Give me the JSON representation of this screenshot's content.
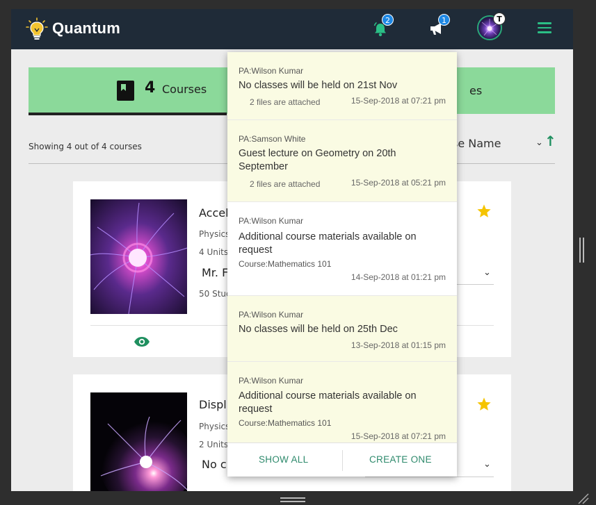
{
  "app": {
    "brand": "Quantum",
    "notifications_badge": "2",
    "announcements_badge": "1",
    "avatar_badge": "T"
  },
  "summary": {
    "course_count": "4",
    "course_label": "Courses",
    "right_label_partial": "es"
  },
  "list": {
    "showing_text": "Showing 4 out of 4 courses",
    "sort_label": "se Name",
    "sort_direction": "ascending"
  },
  "courses": [
    {
      "title_partial": "Accel",
      "subject_partial": "Physics",
      "units_partial": "4 Units",
      "teacher_partial": "Mr. F",
      "students_partial": "50 Stud",
      "starred": true
    },
    {
      "title_partial": "Displ",
      "subject_partial": "Physics",
      "units_partial": "2 Units",
      "teacher_partial": "No c",
      "starred": true
    }
  ],
  "notifications": {
    "items": [
      {
        "from": "PA:Wilson Kumar",
        "message": "No classes will be held on 21st Nov",
        "files": "2 files are attached",
        "time": "15-Sep-2018 at 07:21 pm",
        "unread": true
      },
      {
        "from": "PA:Samson White",
        "message": "Guest lecture on Geometry on 20th September",
        "files": "2 files are attached",
        "time": "15-Sep-2018 at 05:21 pm",
        "unread": true
      },
      {
        "from": "PA:Wilson Kumar",
        "message": "Additional course materials available on request",
        "course": "Course:Mathematics 101",
        "time": "14-Sep-2018 at 01:21 pm",
        "unread": false
      },
      {
        "from": "PA:Wilson Kumar",
        "message": "No classes will be held on 25th Dec",
        "time": "13-Sep-2018 at 01:15 pm",
        "unread": true
      },
      {
        "from": "PA:Wilson Kumar",
        "message": "Additional course materials available on request",
        "course": "Course:Mathematics 101",
        "time": "15-Sep-2018 at 07:21 pm",
        "unread": true
      }
    ],
    "show_all": "SHOW ALL",
    "create_one": "CREATE ONE"
  },
  "colors": {
    "header_bg": "#1f2b38",
    "summary_green": "#8bd99a",
    "accent_green": "#2bbf86",
    "badge_blue": "#1e88e5",
    "star_yellow": "#f5c400",
    "unread_bg": "#fafbe3"
  },
  "icons": {
    "logo": "lightbulb-icon",
    "notifications": "bell-icon",
    "announcements": "megaphone-icon",
    "menu": "hamburger-icon",
    "courses": "book-icon",
    "sort": "arrow-up-icon",
    "favorite": "star-icon",
    "view": "eye-icon"
  }
}
